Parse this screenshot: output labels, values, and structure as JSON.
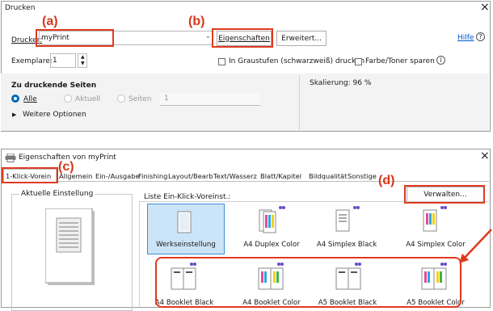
{
  "print_dialog": {
    "title": "Drucken",
    "close": "×",
    "printer_label": "Drucker:",
    "printer_value": "myPrint",
    "properties_button": "Eigenschaften",
    "advanced_button": "Erweitert...",
    "help_link": "Hilfe",
    "help_icon": "?",
    "copies_label": "Exemplare:",
    "copies_value": "1",
    "grayscale_label": "In Graustufen (schwarzweiß) drucken",
    "save_toner_label": "Farbe/Toner sparen",
    "info_icon": "i",
    "pages_heading": "Zu druckende Seiten",
    "radio_all": "Alle",
    "radio_current": "Aktuell",
    "radio_pages": "Seiten",
    "pages_value": "1",
    "more_options": "Weitere Optionen",
    "scaling": "Skalierung:  96 %"
  },
  "properties_dialog": {
    "title": "Eigenschaften von myPrint",
    "close": "×",
    "tabs": [
      "1-Klick-Vorein",
      "Allgemein",
      "Ein-/Ausgabe",
      "Finishing",
      "Layout/Bearb",
      "Text/Wasserz",
      "Blatt/Kapitel",
      "Bildqualität",
      "Sonstige"
    ],
    "current_setting_label": "Aktuelle Einstellung",
    "list_label": "Liste Ein-Klick-Voreinst.:",
    "manage_button": "Verwalten...",
    "presets_row1": [
      "Werkseinstellung",
      "A4 Duplex Color",
      "A4 Simplex Black",
      "A4 Simplex Color"
    ],
    "presets_row2": [
      "A4 Booklet Black",
      "A4 Booklet Color",
      "A5 Booklet Black",
      "A5 Booklet Color"
    ]
  },
  "annotations": {
    "a": "(a)",
    "b": "(b)",
    "c": "(c)",
    "d": "(d)"
  },
  "colors": {
    "annotation_red": "#d8361a",
    "selected_tile": "#cce4f7",
    "radio_blue": "#0067c0"
  }
}
